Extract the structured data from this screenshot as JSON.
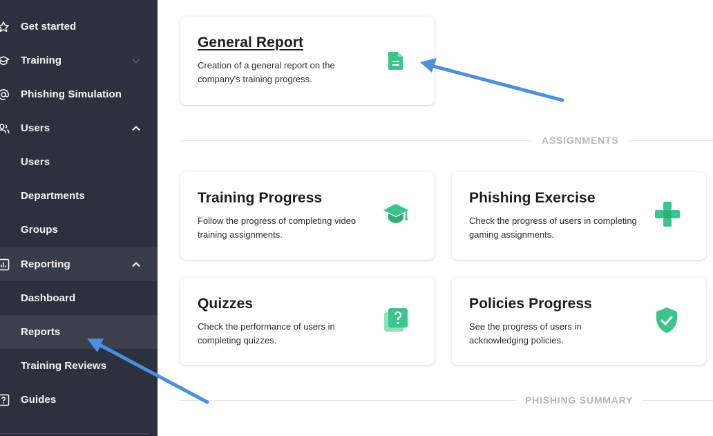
{
  "sidebar": {
    "items": [
      {
        "label": "Get started",
        "icon": "star-icon"
      },
      {
        "label": "Training",
        "icon": "graduation-cap-icon"
      },
      {
        "label": "Phishing Simulation",
        "icon": "at-sign-icon"
      },
      {
        "label": "Users",
        "icon": "users-icon"
      },
      {
        "label": "Users"
      },
      {
        "label": "Departments"
      },
      {
        "label": "Groups"
      },
      {
        "label": "Reporting",
        "icon": "bar-chart-icon"
      },
      {
        "label": "Dashboard"
      },
      {
        "label": "Reports"
      },
      {
        "label": "Training Reviews"
      },
      {
        "label": "Guides",
        "icon": "question-icon"
      }
    ]
  },
  "main": {
    "general_report": {
      "title": "General Report",
      "desc": "Creation of a general report on the company's training progress."
    },
    "sections": {
      "assignments": "ASSIGNMENTS",
      "phishing_summary": "PHISHING SUMMARY"
    },
    "cards": [
      {
        "title": "Training Progress",
        "desc": "Follow the progress of completing video training assignments.",
        "icon": "graduation-cap-icon"
      },
      {
        "title": "Phishing Exercise",
        "desc": "Check the progress of users in completing gaming assignments.",
        "icon": "gamepad-icon"
      },
      {
        "title": "Quizzes",
        "desc": "Check the performance of users in completing quizzes.",
        "icon": "quiz-icon"
      },
      {
        "title": "Policies Progress",
        "desc": "See the progress of users in acknowledging policies.",
        "icon": "shield-check-icon"
      }
    ]
  },
  "colors": {
    "sidebar_bg": "#2c313d",
    "accent_green": "#3cc48d",
    "arrow_blue": "#4a8fe0"
  }
}
